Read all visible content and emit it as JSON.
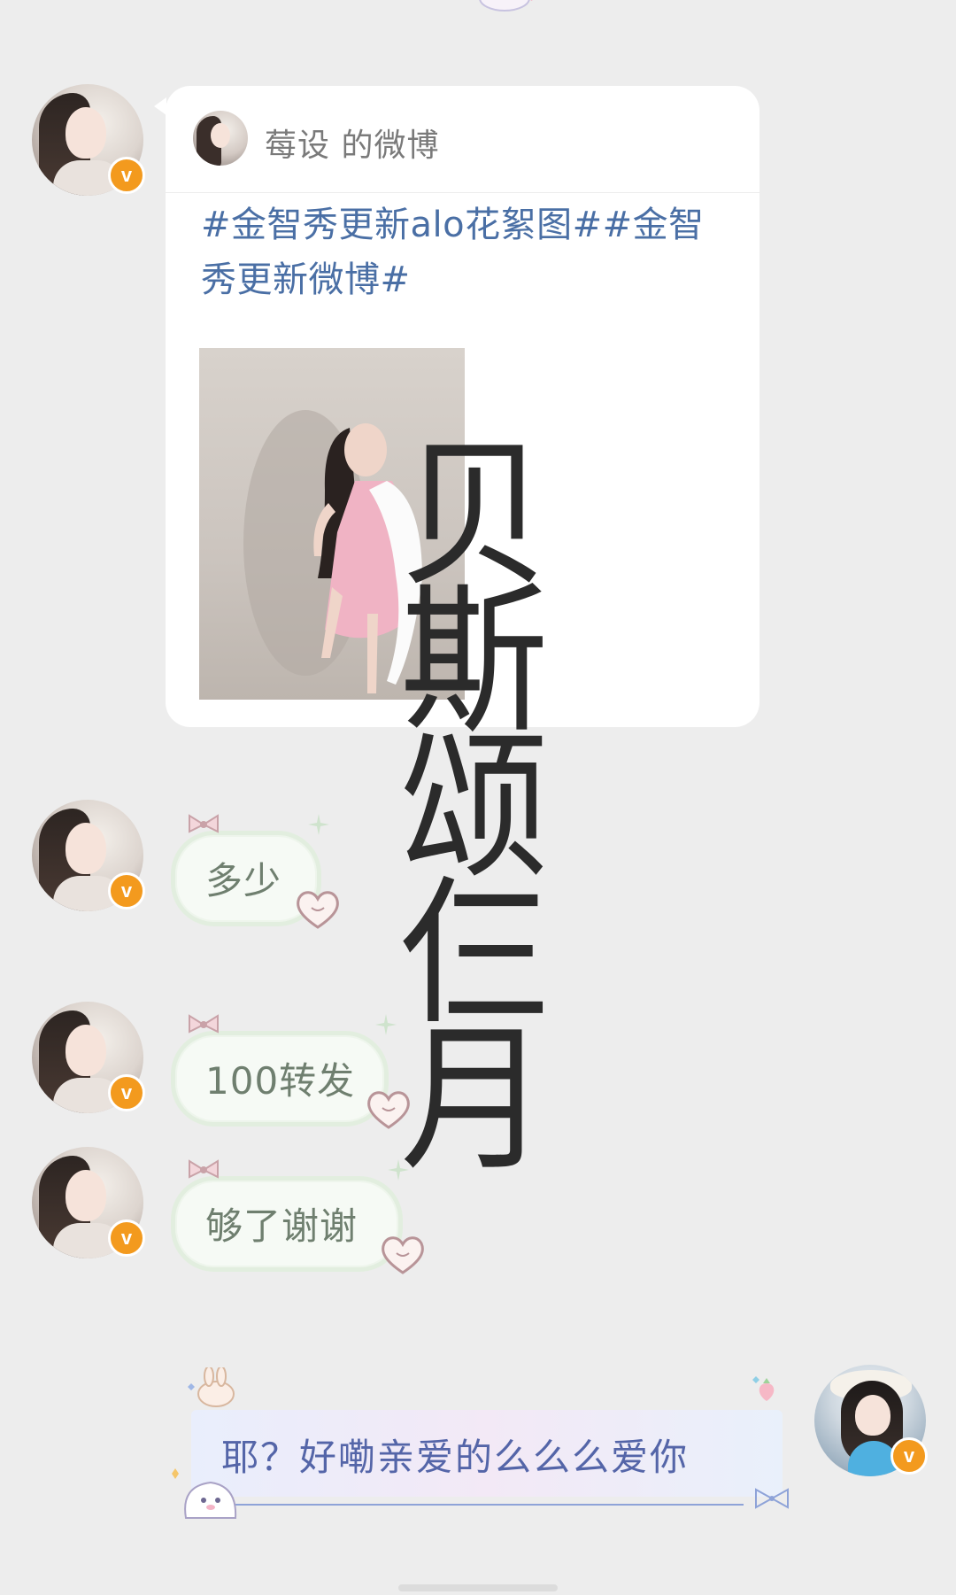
{
  "card": {
    "source": "莓设 的微博",
    "text": "#金智秀更新alo花絮图##金智秀更新微博#"
  },
  "messages": [
    {
      "text": "多少"
    },
    {
      "text": "100转发"
    },
    {
      "text": "够了谢谢"
    }
  ],
  "my_message": {
    "text": "耶？好嘞亲爱的么么么爱你"
  },
  "badge_glyph": "v",
  "watermark": [
    "贝",
    "斯",
    "颂",
    "仨",
    "月"
  ]
}
